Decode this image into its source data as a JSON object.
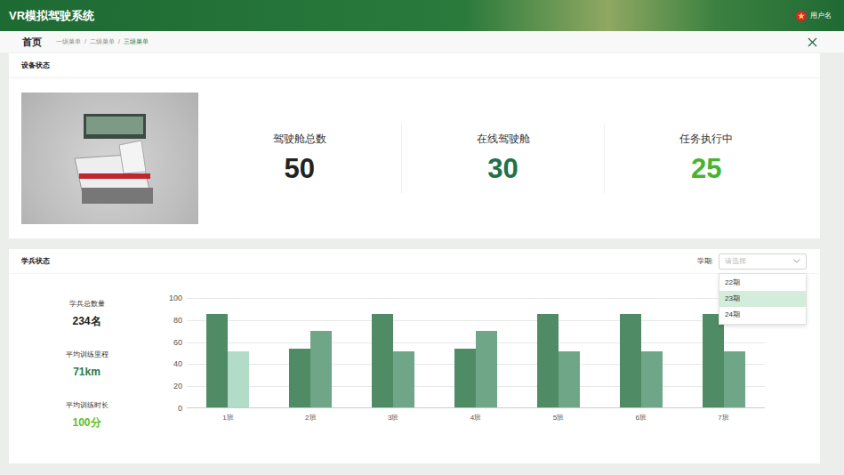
{
  "header": {
    "title": "VR模拟驾驶系统",
    "user": "用户名"
  },
  "breadcrumb": {
    "home": "首页",
    "items": [
      "一级菜单",
      "二级菜单",
      "三级菜单"
    ],
    "separator": "/"
  },
  "device_panel": {
    "title": "设备状态",
    "stats": [
      {
        "label": "驾驶舱总数",
        "value": "50",
        "color": "#222222"
      },
      {
        "label": "在线驾驶舱",
        "value": "30",
        "color": "#23704a"
      },
      {
        "label": "任务执行中",
        "value": "25",
        "color": "#46b52d"
      }
    ]
  },
  "student_panel": {
    "title": "学兵状态",
    "term_label": "学期:",
    "term_select": {
      "placeholder": "请选择",
      "expanded": true,
      "options": [
        {
          "label": "22期",
          "selected": false
        },
        {
          "label": "23期",
          "selected": true
        },
        {
          "label": "24期",
          "selected": false
        }
      ]
    },
    "stats": [
      {
        "label": "学兵总数量",
        "value": "234名",
        "color": "#222222"
      },
      {
        "label": "平均训练里程",
        "value": "71km",
        "color": "#2a7a4c"
      },
      {
        "label": "平均训练时长",
        "value": "100分",
        "color": "#5cbf2a"
      }
    ],
    "chart": {
      "y_max": 100,
      "y_ticks": [
        "100",
        "80",
        "60",
        "40",
        "20",
        "0"
      ],
      "categories": [
        "1班",
        "2班",
        "3班",
        "4班",
        "5班",
        "6班",
        "7班"
      ],
      "series": [
        {
          "values": [
            85,
            53,
            85,
            53,
            85,
            85,
            85
          ],
          "color": "#4f8c66"
        },
        {
          "values": [
            51,
            69,
            51,
            69,
            51,
            51,
            51
          ],
          "color": "#6fa688"
        }
      ],
      "highlight": {
        "series": 1,
        "index": 0,
        "color": "#b2dcc7"
      }
    }
  }
}
